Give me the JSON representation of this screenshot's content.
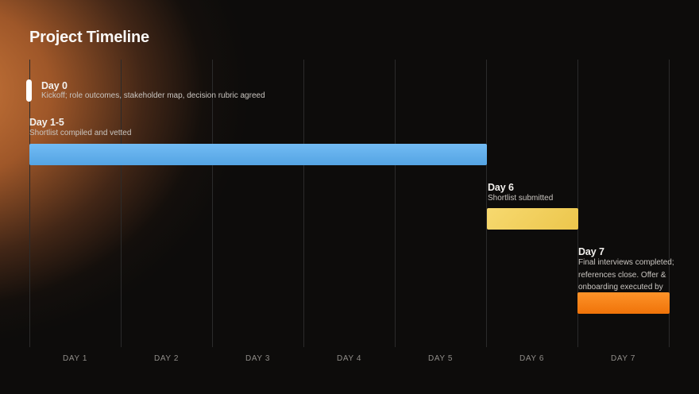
{
  "title": "Project Timeline",
  "axis": {
    "labels": [
      "DAY 1",
      "DAY 2",
      "DAY 3",
      "DAY 4",
      "DAY 5",
      "DAY 6",
      "DAY 7"
    ]
  },
  "milestones": [
    {
      "label": "Day 0",
      "description": "Kickoff; role outcomes, stakeholder map, decision rubric agreed"
    },
    {
      "label": "Day 1-5",
      "description": "Shortlist compiled and vetted"
    },
    {
      "label": "Day 6",
      "description": "Shortlist submitted"
    },
    {
      "label": "Day 7",
      "description": "Final interviews completed; references close. Offer & onboarding executed by client",
      "description_lines": [
        "Final interviews completed;",
        "references close. Offer &",
        "onboarding executed by client"
      ]
    }
  ],
  "colors": {
    "bg_base": "#0d0c0b",
    "glow": "#cd7a3d",
    "gridline": "#2b2b2b",
    "axis_text": "#908d89",
    "label_text": "#f3f1ee",
    "desc_text": "#c9c5c0",
    "marker_white": "#ffffff",
    "bar_blue_top": "#72bbf4",
    "bar_blue_bottom": "#54a4e3",
    "bar_yellow_top": "#f7d96f",
    "bar_yellow_bottom": "#ecc64c",
    "bar_orange_top": "#fd9329",
    "bar_orange_bottom": "#f07309"
  },
  "chart_data": {
    "type": "bar",
    "subtype": "gantt-timeline",
    "title": "Project Timeline",
    "x_axis_labels": [
      "DAY 1",
      "DAY 2",
      "DAY 3",
      "DAY 4",
      "DAY 5",
      "DAY 6",
      "DAY 7"
    ],
    "x_range_days": [
      0,
      7
    ],
    "grid": "vertical day gridlines, 8 lines at day boundaries 0-7",
    "legend": "none",
    "background": "near-black with warm orange radial glow in top-left",
    "series": [
      {
        "name": "Day 0",
        "description": "Kickoff; role outcomes, stakeholder map, decision rubric agreed",
        "start_day": 0,
        "end_day": 0,
        "style": "milestone-marker",
        "color": "#ffffff"
      },
      {
        "name": "Day 1-5",
        "description": "Shortlist compiled and vetted",
        "start_day": 0,
        "end_day": 5,
        "style": "bar",
        "color": "#5fb0ee"
      },
      {
        "name": "Day 6",
        "description": "Shortlist submitted",
        "start_day": 5,
        "end_day": 6,
        "style": "bar",
        "color": "#f2cd5f"
      },
      {
        "name": "Day 7",
        "description": "Final interviews completed; references close. Offer & onboarding executed by client",
        "start_day": 6,
        "end_day": 7,
        "style": "bar",
        "color": "#f8891c"
      }
    ]
  }
}
